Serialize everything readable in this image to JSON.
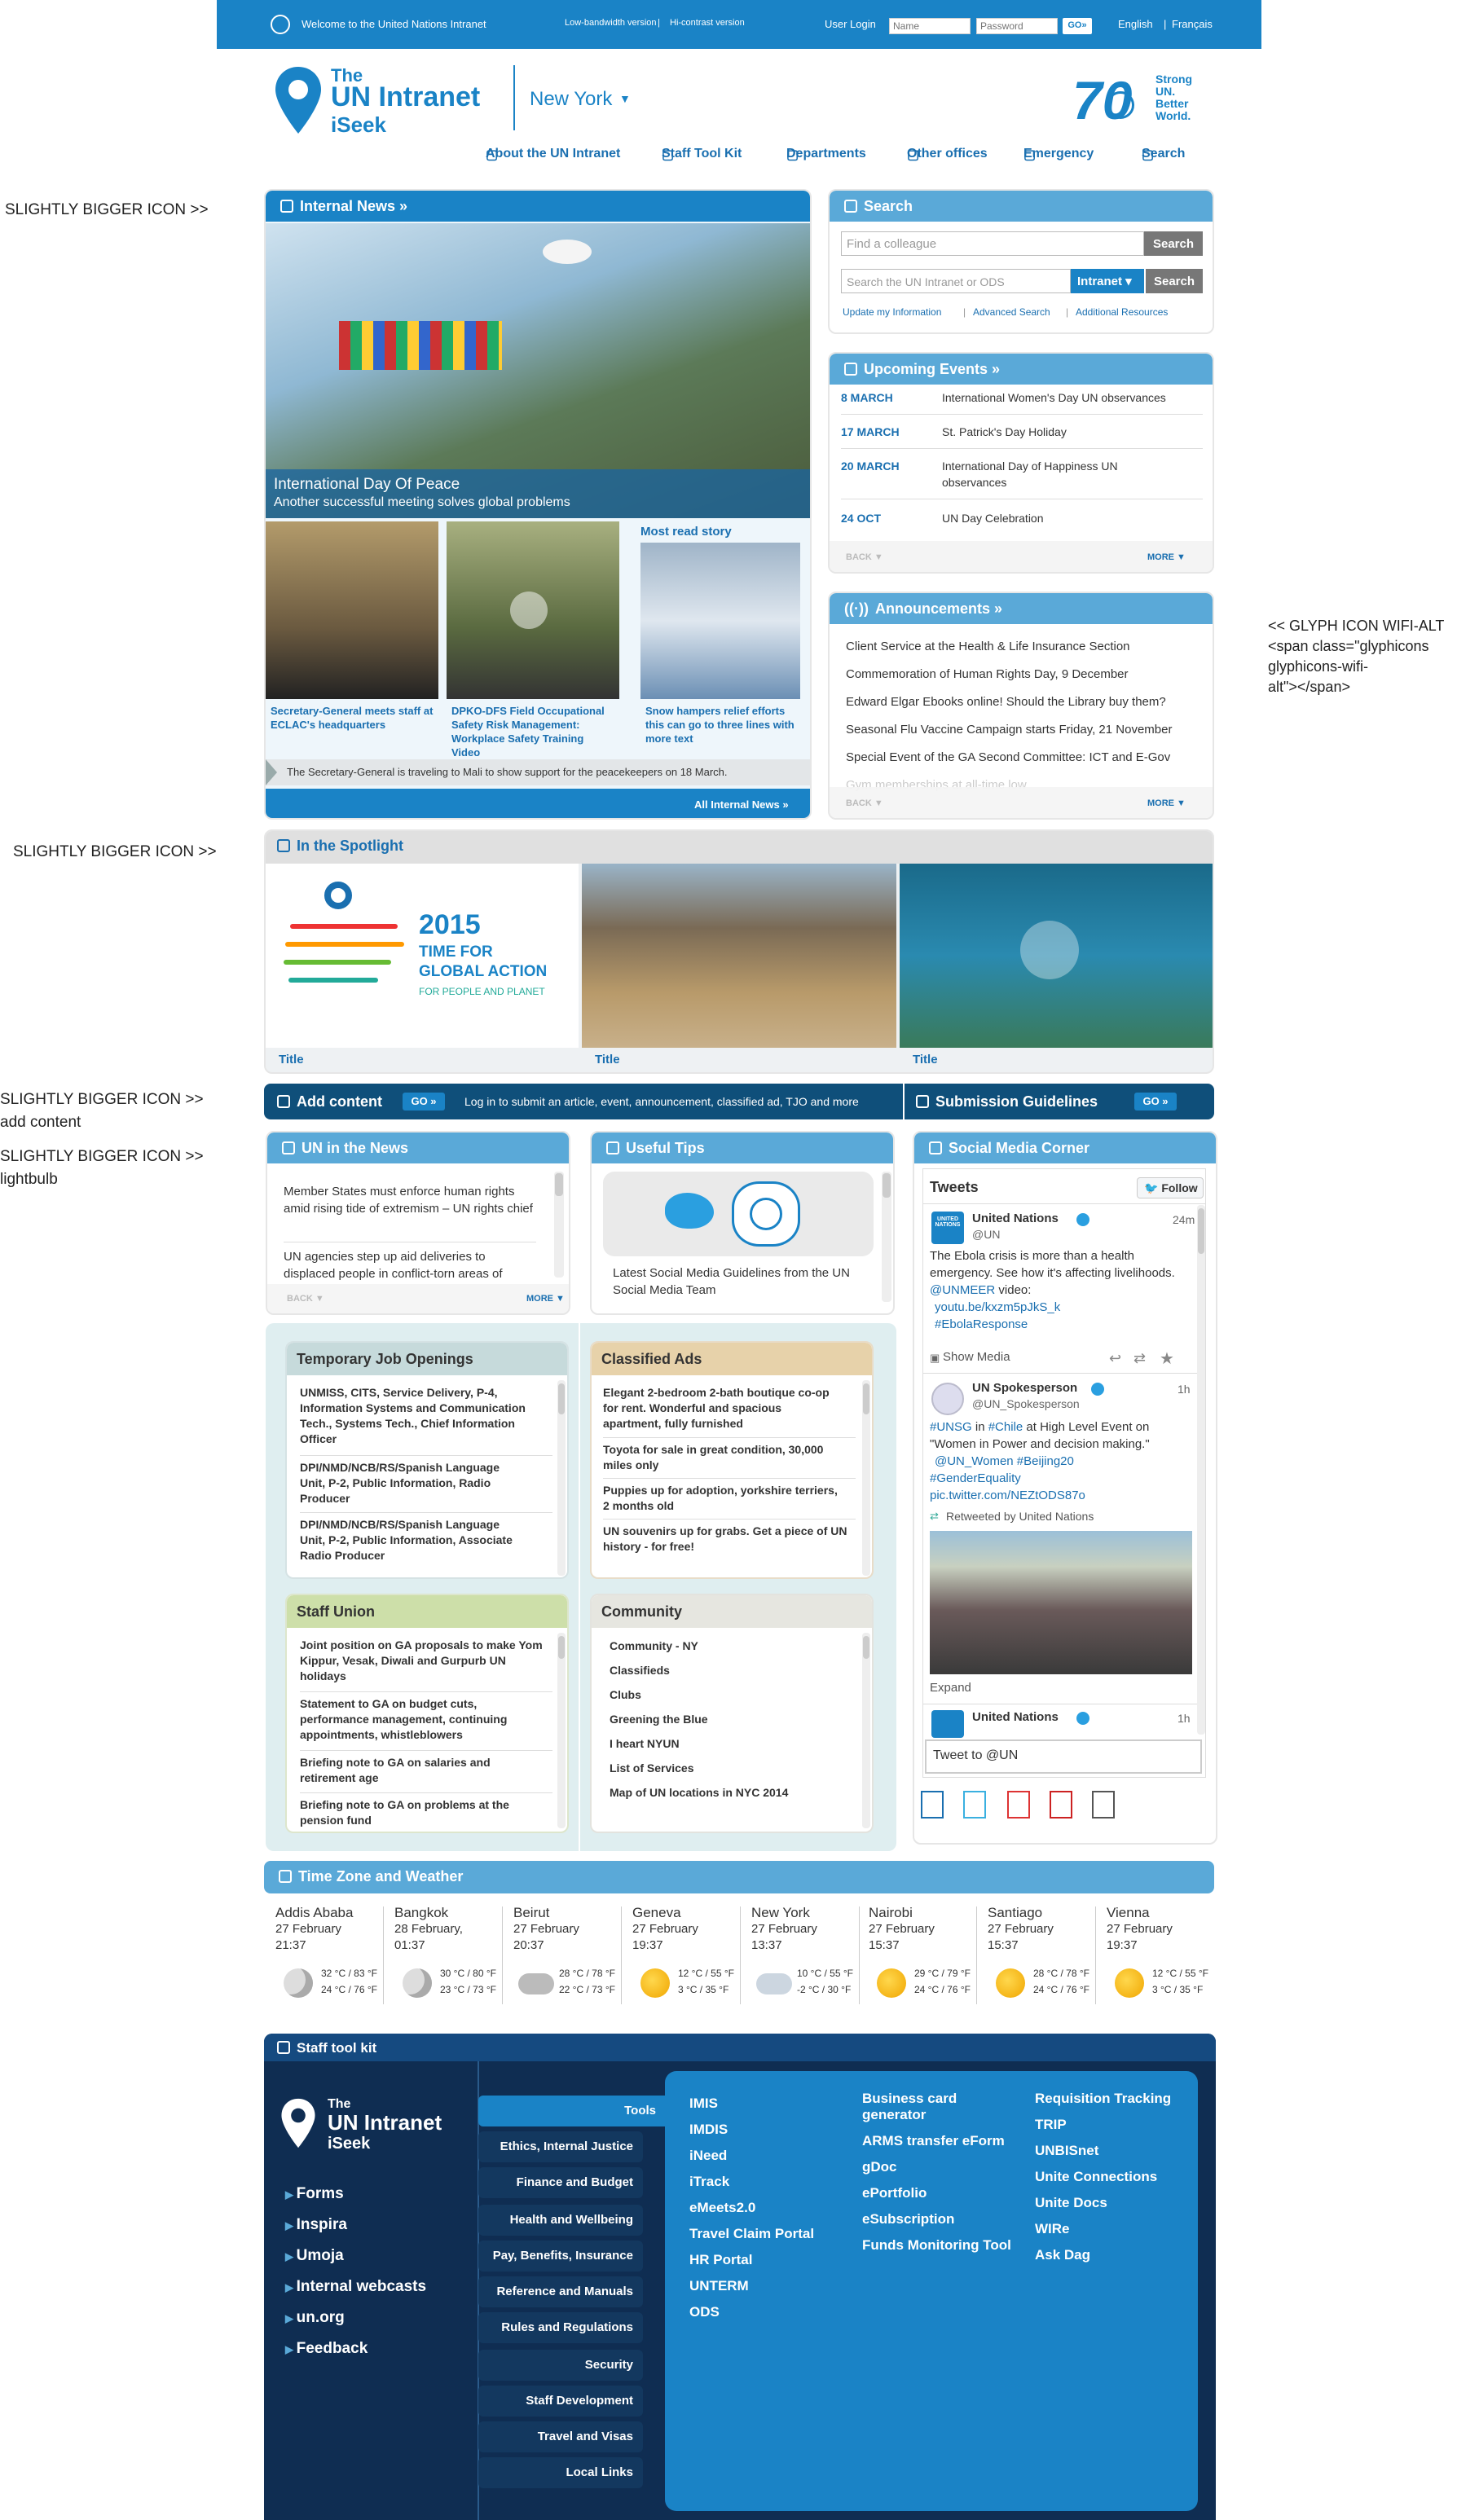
{
  "topbar": {
    "welcome": "Welcome to the United Nations Intranet",
    "low_bandwidth": "Low-bandwidth version",
    "hi_contrast": "Hi-contrast version",
    "user_login": "User Login",
    "name_placeholder": "Name",
    "password_placeholder": "Password",
    "go": "GO»",
    "lang_en": "English",
    "lang_fr": "Français"
  },
  "header": {
    "title_the": "The",
    "title_main": "UN Intranet",
    "title_sub": "iSeek",
    "location": "New York",
    "location_caret": "▼",
    "badge_70": "70",
    "badge_line1": "Strong",
    "badge_line2": "UN.",
    "badge_line3": "Better",
    "badge_line4": "World."
  },
  "nav": [
    "About the UN Intranet",
    "Staff Tool Kit",
    "Departments",
    "Other offices",
    "Emergency",
    "Search"
  ],
  "annotations": {
    "a1": "SLIGHTLY BIGGER ICON >>",
    "a2": "SLIGHTLY BIGGER ICON >>",
    "a3": "SLIGHTLY BIGGER ICON >>",
    "a3b": "add content",
    "a4": "SLIGHTLY BIGGER ICON >>",
    "a4b": "lightbulb",
    "r1": "<< GLYPH ICON WIFI-ALT",
    "r2": "<span class=\"glyphicons",
    "r3": "glyphicons-wifi-",
    "r4": "alt\"></span>"
  },
  "news": {
    "header": "Internal News »",
    "hero_title": "International Day Of Peace",
    "hero_sub": "Another successful meeting solves global problems",
    "cap1": "Secretary-General meets staff at ECLAC's headquarters",
    "cap2": "DPKO-DFS Field Occupational Safety Risk Management: Workplace Safety Training Video",
    "most_read": "Most read story",
    "cap3": "Snow hampers relief efforts this can go to three lines with more text",
    "ticker": "The Secretary-General is traveling to Mali to show support for the peacekeepers on 18 March.",
    "all": "All Internal News »"
  },
  "search": {
    "header": "Search",
    "colleague_placeholder": "Find a colleague",
    "btn": "Search",
    "site_placeholder": "Search the UN Intranet or ODS",
    "scope": "Intranet ▾",
    "btn2": "Search",
    "links": [
      "Update my Information",
      "Advanced Search",
      "Additional Resources"
    ]
  },
  "events": {
    "header": "Upcoming Events »",
    "items": [
      {
        "date": "8 MARCH",
        "text": "International Women's Day UN observances"
      },
      {
        "date": "17 MARCH",
        "text": "St. Patrick's Day Holiday"
      },
      {
        "date": "20 MARCH",
        "text": "International Day of Happiness UN observances"
      },
      {
        "date": "24 OCT",
        "text": "UN Day Celebration"
      }
    ],
    "back": "BACK ▼",
    "more": "MORE ▼"
  },
  "announcements": {
    "header": "Announcements »",
    "items": [
      "Client Service at the Health & Life Insurance Section",
      "Commemoration of Human Rights Day, 9 December",
      "Edward Elgar Ebooks online! Should the Library buy them?",
      "Seasonal Flu Vaccine Campaign starts Friday, 21 November",
      "Special Event of the GA Second Committee: ICT and E-Gov",
      "Gym memberships at all-time low"
    ],
    "back": "BACK ▼",
    "more": "MORE ▼"
  },
  "spotlight": {
    "header": "In the Spotlight",
    "g_2015": "2015",
    "g_line1": "TIME FOR",
    "g_line2": "GLOBAL ACTION",
    "g_line3": "FOR PEOPLE AND PLANET",
    "titles": [
      "Title",
      "Title",
      "Title"
    ]
  },
  "addcontent": {
    "label": "Add content",
    "go": "GO »",
    "text": "Log in to submit an article, event, announcement, classified ad, TJO and more",
    "guidelines": "Submission Guidelines",
    "go2": "GO »"
  },
  "uninnews": {
    "header": "UN in the News",
    "items": [
      "Member States must enforce human rights amid rising tide of extremism – UN rights chief",
      "UN agencies step up aid deliveries to displaced people in conflict-torn areas of"
    ],
    "back": "BACK ▼",
    "more": "MORE ▼"
  },
  "tips": {
    "header": "Useful Tips",
    "text": "Latest Social Media Guidelines from the UN Social Media Team"
  },
  "social": {
    "header": "Social Media Corner",
    "tweets": "Tweets",
    "follow": "Follow",
    "t1_name": "United Nations",
    "t1_handle": "@UN",
    "t1_time": "24m",
    "t1_text": "The Ebola crisis is more than a health emergency. See how it's affecting livelihoods.",
    "t1_link1": "@UNMEER",
    "t1_link2": "video:",
    "t1_url": "youtu.be/kxzm5pJkS_k",
    "t1_tag": "#EbolaResponse",
    "show_media": "Show Media",
    "t2_name": "UN Spokesperson",
    "t2_handle": "@UN_Spokesperson",
    "t2_time": "1h",
    "t2_tag1": "#UNSG",
    "t2_in": "in",
    "t2_tag2": "#Chile",
    "t2_text1": "at High Level Event on",
    "t2_text2": "\"Women in Power and decision making.\"",
    "t2_mentions": "@UN_Women #Beijing20",
    "t2_tag3": "#GenderEquality",
    "t2_url": "pic.twitter.com/NEZtODS87o",
    "t2_rt": "Retweeted by United Nations",
    "expand": "Expand",
    "t3_name": "United Nations",
    "t3_time": "1h",
    "tweet_to": "Tweet to @UN",
    "badge": "UNITED NATIONS"
  },
  "jobs": {
    "header": "Temporary Job Openings",
    "items": [
      "UNMISS, CITS, Service Delivery, P-4, Information Systems and Communication Tech., Systems Tech., Chief Information Officer",
      "DPI/NMD/NCB/RS/Spanish Language Unit, P-2, Public Information, Radio Producer",
      "DPI/NMD/NCB/RS/Spanish Language Unit, P-2, Public Information, Associate Radio Producer"
    ]
  },
  "classified": {
    "header": "Classified Ads",
    "items": [
      "Elegant 2-bedroom 2-bath boutique co-op for rent. Wonderful and spacious apartment, fully furnished",
      "Toyota for sale in great condition, 30,000 miles only",
      "Puppies up for adoption, yorkshire terriers, 2 months old",
      "UN souvenirs up for grabs. Get a piece of UN history - for free!"
    ]
  },
  "union": {
    "header": "Staff Union",
    "items": [
      "Joint position on GA proposals to make Yom Kippur, Vesak, Diwali and Gurpurb UN holidays",
      "Statement to GA on budget cuts, performance management, continuing appointments, whistleblowers",
      "Briefing note to GA on salaries and retirement age",
      "Briefing note to GA on problems at the pension fund"
    ]
  },
  "community": {
    "header": "Community",
    "items": [
      "Community - NY",
      "Classifieds",
      "Clubs",
      "Greening the Blue",
      "I heart NYUN",
      "List of Services",
      "Map of UN locations in NYC 2014"
    ]
  },
  "weather": {
    "header": "Time Zone and Weather",
    "cities": [
      {
        "city": "Addis Ababa",
        "date": "27 February",
        "time": "21:37",
        "t1": "32 °C / 83 °F",
        "t2": "24 °C / 76 °F",
        "icon": "moon"
      },
      {
        "city": "Bangkok",
        "date": "28 February,",
        "time": "01:37",
        "t1": "30 °C / 80 °F",
        "t2": "23 °C / 73 °F",
        "icon": "moon"
      },
      {
        "city": "Beirut",
        "date": "27 February",
        "time": "20:37",
        "t1": "28 °C / 78 °F",
        "t2": "22 °C / 73 °F",
        "icon": "cloud"
      },
      {
        "city": "Geneva",
        "date": "27 February",
        "time": "19:37",
        "t1": "12 °C / 55 °F",
        "t2": "3 °C / 35 °F",
        "icon": "sun"
      },
      {
        "city": "New York",
        "date": "27 February",
        "time": "13:37",
        "t1": "10 °C / 55 °F",
        "t2": "-2 °C / 30 °F",
        "icon": "snow"
      },
      {
        "city": "Nairobi",
        "date": "27 February",
        "time": "15:37",
        "t1": "29 °C / 79 °F",
        "t2": "24 °C / 76 °F",
        "icon": "sun"
      },
      {
        "city": "Santiago",
        "date": "27 February",
        "time": "15:37",
        "t1": "28 °C / 78 °F",
        "t2": "24 °C / 76 °F",
        "icon": "sun"
      },
      {
        "city": "Vienna",
        "date": "27 February",
        "time": "19:37",
        "t1": "12 °C / 55 °F",
        "t2": "3 °C / 35 °F",
        "icon": "sun"
      }
    ]
  },
  "toolkit": {
    "header": "Staff tool kit",
    "logo_the": "The",
    "logo_main": "UN Intranet",
    "logo_sub": "iSeek",
    "left_links": [
      "Forms",
      "Inspira",
      "Umoja",
      "Internal webcasts",
      "un.org",
      "Feedback"
    ],
    "categories": [
      "Tools",
      "Ethics, Internal Justice",
      "Finance and Budget",
      "Health and Wellbeing",
      "Pay, Benefits, Insurance",
      "Reference and Manuals",
      "Rules and Regulations",
      "Security",
      "Staff Development",
      "Travel and Visas",
      "Local Links"
    ],
    "col1": [
      "IMIS",
      "IMDIS",
      "iNeed",
      "iTrack",
      "eMeets2.0",
      "Travel Claim Portal",
      "HR Portal",
      "UNTERM",
      "ODS"
    ],
    "col2": [
      "Business card generator",
      "ARMS transfer eForm",
      "gDoc",
      "ePortfolio",
      "eSubscription",
      "Funds Monitoring Tool"
    ],
    "col3": [
      "Requisition Tracking",
      "TRIP",
      "UNBISnet",
      "Unite Connections",
      "Unite Docs",
      "WIRe",
      "Ask Dag"
    ]
  },
  "colors": {
    "brand": "#1a83c6",
    "light_blue": "#5aa9d8",
    "navy": "#0f2d52",
    "teal_bg": "#dfeef0"
  }
}
